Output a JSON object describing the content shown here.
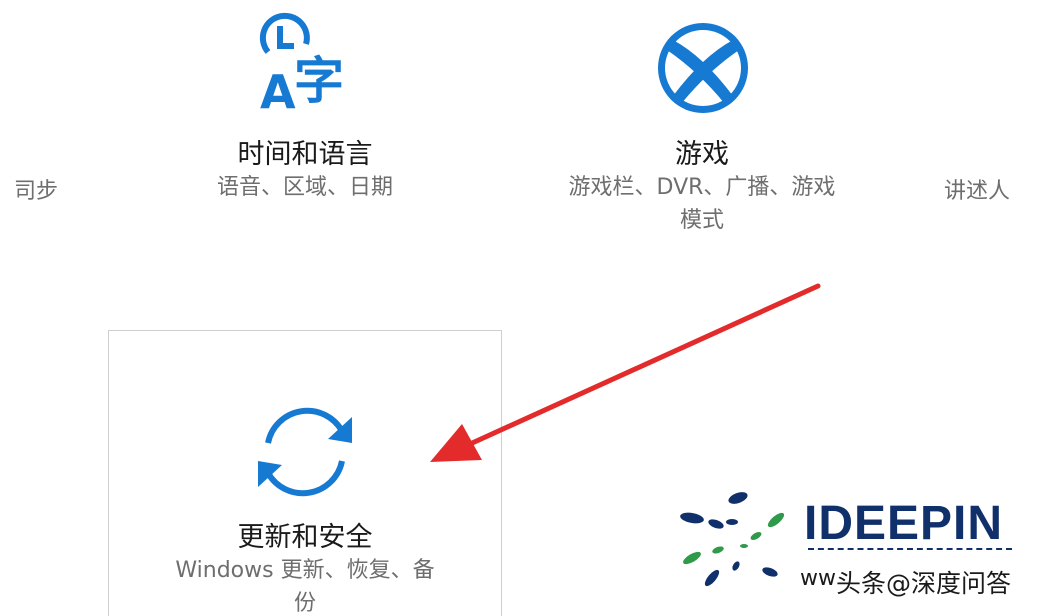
{
  "settings": {
    "tiles": [
      {
        "id": "time-language",
        "title": "时间和语言",
        "description": "语音、区域、日期",
        "icon": "time-language-icon"
      },
      {
        "id": "gaming",
        "title": "游戏",
        "description_line1": "游戏栏、DVR、广播、游戏",
        "description_line2": "模式",
        "icon": "xbox-icon"
      },
      {
        "id": "update-security",
        "title": "更新和安全",
        "description_line1": "Windows 更新、恢复、备",
        "description_line2": "份",
        "icon": "sync-icon"
      }
    ],
    "partial_left_label": "司步",
    "partial_right_label": "讲述人"
  },
  "annotation": {
    "arrow_color": "#e32b2b"
  },
  "watermark": {
    "brand": "IDEEPIN",
    "caption": "头条@深度问答",
    "url_fragment": "ww"
  },
  "colors": {
    "accent": "#1679d2",
    "title": "#1a1a1a",
    "description": "#6e6e6e",
    "border": "#cfcfcf",
    "brand_navy": "#10306b",
    "brand_green": "#2e9a4a"
  }
}
